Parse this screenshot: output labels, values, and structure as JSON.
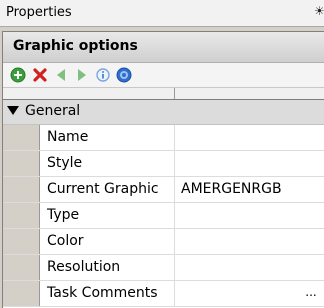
{
  "window": {
    "title": "Properties",
    "pin_glyph": "☀"
  },
  "panel": {
    "header": "Graphic options"
  },
  "toolbar": {
    "buttons": [
      {
        "icon": "add-icon",
        "color": "#3a9e3a"
      },
      {
        "icon": "delete-icon",
        "color": "#d02020"
      },
      {
        "icon": "back-arrow-icon",
        "color": "#7fbf7f"
      },
      {
        "icon": "forward-arrow-icon",
        "color": "#7fbf7f"
      },
      {
        "icon": "info-icon",
        "color": "#7aa7e0"
      },
      {
        "icon": "help-icon",
        "color": "#2f6fd0"
      }
    ]
  },
  "grid": {
    "category": "General",
    "rows": [
      {
        "name": "Name",
        "value": ""
      },
      {
        "name": "Style",
        "value": ""
      },
      {
        "name": "Current Graphic",
        "value": "AMERGENRGB"
      },
      {
        "name": "Type",
        "value": ""
      },
      {
        "name": "Color",
        "value": ""
      },
      {
        "name": "Resolution",
        "value": ""
      },
      {
        "name": "Task Comments",
        "value": "",
        "ellipsis": "..."
      }
    ]
  }
}
